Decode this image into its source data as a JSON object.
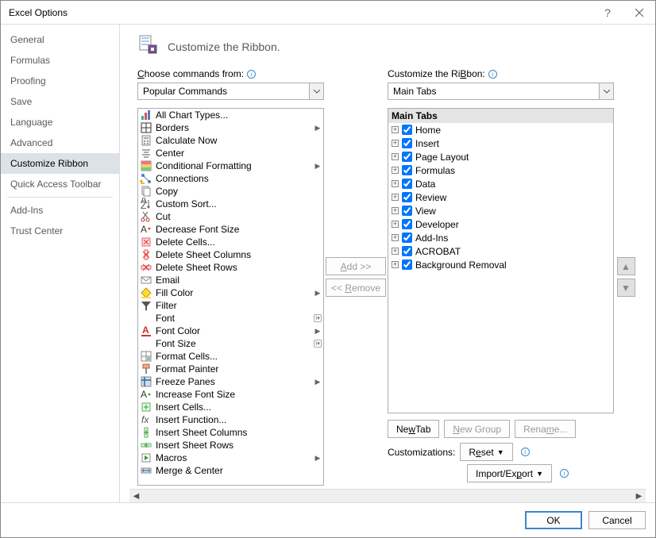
{
  "title": "Excel Options",
  "header": "Customize the Ribbon.",
  "sidebar": {
    "items": [
      "General",
      "Formulas",
      "Proofing",
      "Save",
      "Language",
      "Advanced",
      "Customize Ribbon",
      "Quick Access Toolbar",
      "Add-Ins",
      "Trust Center"
    ],
    "selected": 6,
    "separatorsAfter": [
      7
    ]
  },
  "choose": {
    "label": "Choose commands from:",
    "value": "Popular Commands"
  },
  "customize": {
    "label": "Customize the Ribbon:",
    "value": "Main Tabs"
  },
  "commands": [
    {
      "n": "All Chart Types...",
      "sub": ""
    },
    {
      "n": "Borders",
      "sub": "▶"
    },
    {
      "n": "Calculate Now",
      "sub": ""
    },
    {
      "n": "Center",
      "sub": ""
    },
    {
      "n": "Conditional Formatting",
      "sub": "▶"
    },
    {
      "n": "Connections",
      "sub": ""
    },
    {
      "n": "Copy",
      "sub": ""
    },
    {
      "n": "Custom Sort...",
      "sub": ""
    },
    {
      "n": "Cut",
      "sub": ""
    },
    {
      "n": "Decrease Font Size",
      "sub": ""
    },
    {
      "n": "Delete Cells...",
      "sub": ""
    },
    {
      "n": "Delete Sheet Columns",
      "sub": ""
    },
    {
      "n": "Delete Sheet Rows",
      "sub": ""
    },
    {
      "n": "Email",
      "sub": ""
    },
    {
      "n": "Fill Color",
      "sub": "▶"
    },
    {
      "n": "Filter",
      "sub": ""
    },
    {
      "n": "Font",
      "sub": "I"
    },
    {
      "n": "Font Color",
      "sub": "▶"
    },
    {
      "n": "Font Size",
      "sub": "I"
    },
    {
      "n": "Format Cells...",
      "sub": ""
    },
    {
      "n": "Format Painter",
      "sub": ""
    },
    {
      "n": "Freeze Panes",
      "sub": "▶"
    },
    {
      "n": "Increase Font Size",
      "sub": ""
    },
    {
      "n": "Insert Cells...",
      "sub": ""
    },
    {
      "n": "Insert Function...",
      "sub": ""
    },
    {
      "n": "Insert Sheet Columns",
      "sub": ""
    },
    {
      "n": "Insert Sheet Rows",
      "sub": ""
    },
    {
      "n": "Macros",
      "sub": "▶"
    },
    {
      "n": "Merge & Center",
      "sub": ""
    }
  ],
  "treeHeader": "Main Tabs",
  "tabs": [
    {
      "n": "Home",
      "c": true
    },
    {
      "n": "Insert",
      "c": true
    },
    {
      "n": "Page Layout",
      "c": true
    },
    {
      "n": "Formulas",
      "c": true
    },
    {
      "n": "Data",
      "c": true
    },
    {
      "n": "Review",
      "c": true
    },
    {
      "n": "View",
      "c": true
    },
    {
      "n": "Developer",
      "c": true
    },
    {
      "n": "Add-Ins",
      "c": true
    },
    {
      "n": "ACROBAT",
      "c": true
    },
    {
      "n": "Background Removal",
      "c": true
    }
  ],
  "buttons": {
    "add": "Add >>",
    "remove": "<< Remove",
    "newTab": "New Tab",
    "newGroup": "New Group",
    "rename": "Rename...",
    "customLabel": "Customizations:",
    "reset": "Reset",
    "importExport": "Import/Export",
    "ok": "OK",
    "cancel": "Cancel"
  }
}
